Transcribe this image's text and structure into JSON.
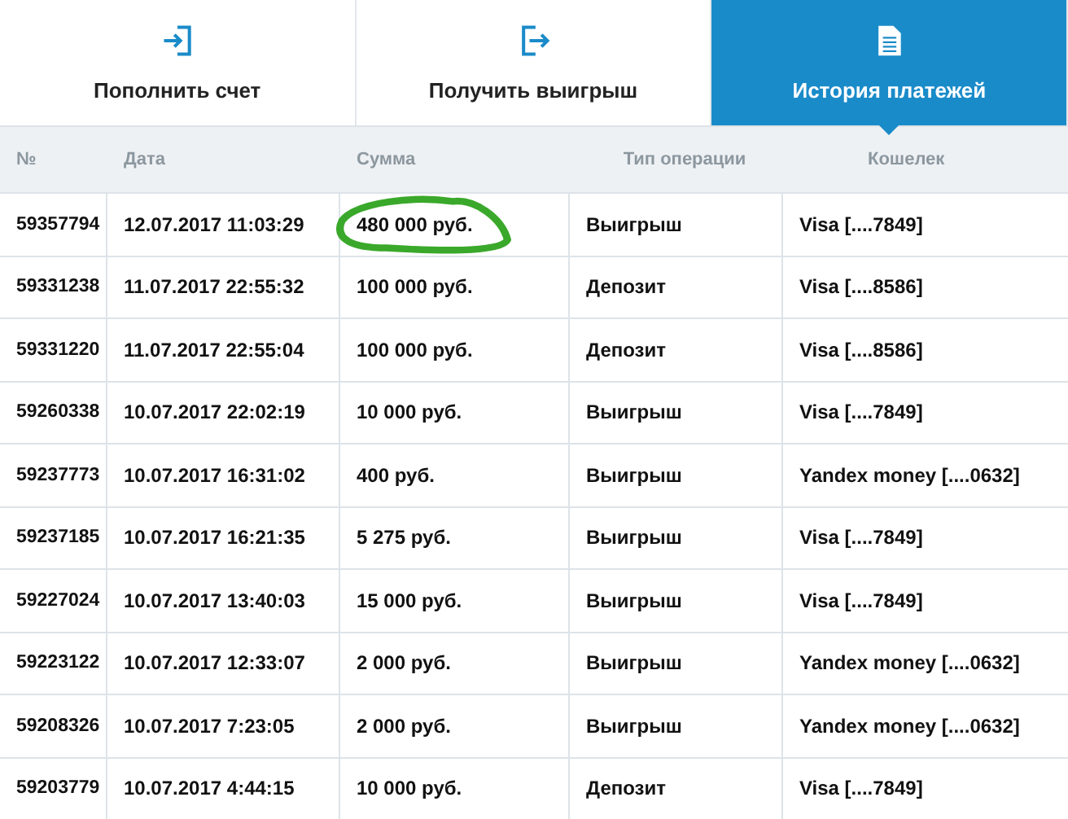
{
  "tabs": [
    {
      "label": "Пополнить счет",
      "kind": "deposit",
      "selected": false
    },
    {
      "label": "Получить выигрыш",
      "kind": "withdraw",
      "selected": false
    },
    {
      "label": "История платежей",
      "kind": "history",
      "selected": true
    }
  ],
  "table": {
    "columns": [
      "№",
      "Дата",
      "Сумма",
      "Тип операции",
      "Кошелек"
    ],
    "rows": [
      {
        "cells": [
          "59357794",
          "12.07.2017 11:03:29",
          "480 000 руб.",
          "Выигрыш",
          "Visa [....7849]"
        ],
        "circled": true
      },
      {
        "cells": [
          "59331238",
          "11.07.2017 22:55:32",
          "100 000 руб.",
          "Депозит",
          "Visa [....8586]"
        ],
        "circled": false
      },
      {
        "cells": [
          "59331220",
          "11.07.2017 22:55:04",
          "100 000 руб.",
          "Депозит",
          "Visa [....8586]"
        ],
        "circled": false
      },
      {
        "cells": [
          "59260338",
          "10.07.2017 22:02:19",
          "10 000 руб.",
          "Выигрыш",
          "Visa [....7849]"
        ],
        "circled": false
      },
      {
        "cells": [
          "59237773",
          "10.07.2017 16:31:02",
          "400 руб.",
          "Выигрыш",
          "Yandex money [....0632]"
        ],
        "circled": false
      },
      {
        "cells": [
          "59237185",
          "10.07.2017 16:21:35",
          "5 275 руб.",
          "Выигрыш",
          "Visa [....7849]"
        ],
        "circled": false
      },
      {
        "cells": [
          "59227024",
          "10.07.2017 13:40:03",
          "15 000 руб.",
          "Выигрыш",
          "Visa [....7849]"
        ],
        "circled": false
      },
      {
        "cells": [
          "59223122",
          "10.07.2017 12:33:07",
          "2 000 руб.",
          "Выигрыш",
          "Yandex money [....0632]"
        ],
        "circled": false
      },
      {
        "cells": [
          "59208326",
          "10.07.2017 7:23:05",
          "2 000 руб.",
          "Выигрыш",
          "Yandex money [....0632]"
        ],
        "circled": false
      },
      {
        "cells": [
          "59203779",
          "10.07.2017 4:44:15",
          "10 000 руб.",
          "Депозит",
          "Visa [....7849]"
        ],
        "circled": false
      }
    ]
  }
}
